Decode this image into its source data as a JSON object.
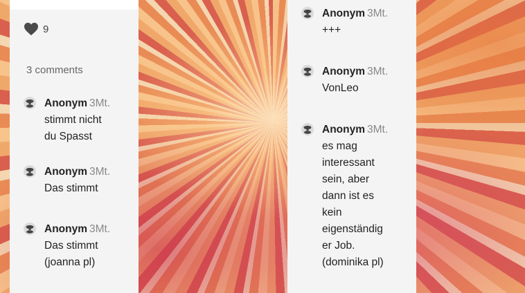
{
  "left": {
    "likes": "9",
    "comments_count": "3 comments",
    "comments": [
      {
        "author": "Anonym",
        "time": "3Mt.",
        "lines": [
          "stimmt nicht",
          "du Spasst"
        ]
      },
      {
        "author": "Anonym",
        "time": "3Mt.",
        "lines": [
          "Das stimmt"
        ]
      },
      {
        "author": "Anonym",
        "time": "3Mt.",
        "lines": [
          "Das stimmt",
          "(joanna pl)"
        ]
      }
    ]
  },
  "right": {
    "comments": [
      {
        "author": "Anonym",
        "time": "3Mt.",
        "lines": [
          "+++"
        ]
      },
      {
        "author": "Anonym",
        "time": "3Mt.",
        "lines": [
          "VonLeo"
        ]
      },
      {
        "author": "Anonym",
        "time": "3Mt.",
        "lines": [
          "es mag",
          "interessant",
          "sein, aber",
          "dann ist es",
          "kein",
          "eigenständig",
          "er Job.",
          "(dominika pl)"
        ]
      }
    ]
  },
  "icons": {
    "like": "heart-icon",
    "avatar": "anonymous-avatar-icon"
  },
  "colors": {
    "panel": "#f4f4f4",
    "text": "#222222",
    "muted": "#888888"
  }
}
